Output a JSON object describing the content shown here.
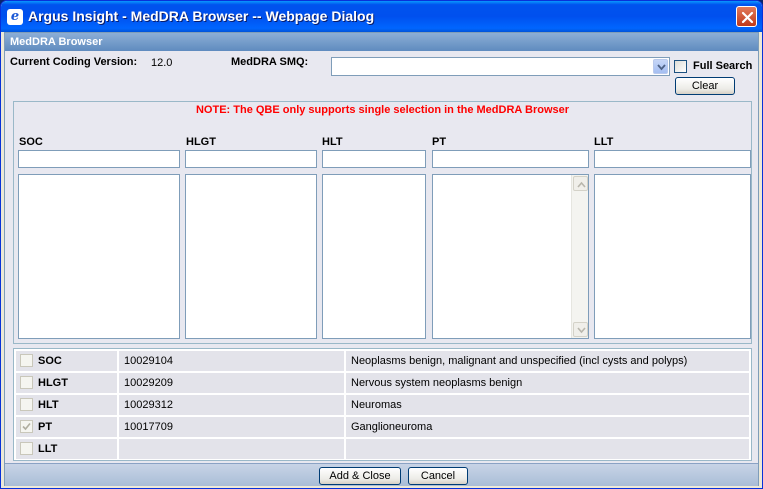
{
  "window": {
    "title": "Argus Insight - MedDRA Browser -- Webpage Dialog",
    "icon": "ie-icon"
  },
  "section_title": "MedDRA Browser",
  "coding": {
    "label": "Current Coding Version:",
    "value": "12.0"
  },
  "smq": {
    "label": "MedDRA SMQ:",
    "selected": ""
  },
  "full_search": {
    "label": "Full Search",
    "checked": false
  },
  "clear_label": "Clear",
  "note": "NOTE: The QBE only supports single selection in the MedDRA Browser",
  "columns": [
    {
      "label": "SOC",
      "input_value": ""
    },
    {
      "label": "HLGT",
      "input_value": ""
    },
    {
      "label": "HLT",
      "input_value": ""
    },
    {
      "label": "PT",
      "input_value": ""
    },
    {
      "label": "LLT",
      "input_value": ""
    }
  ],
  "selection": [
    {
      "level": "SOC",
      "code": "10029104",
      "term": "Neoplasms benign, malignant and unspecified (incl cysts and polyps)",
      "checked": false
    },
    {
      "level": "HLGT",
      "code": "10029209",
      "term": "Nervous system neoplasms benign",
      "checked": false
    },
    {
      "level": "HLT",
      "code": "10029312",
      "term": "Neuromas",
      "checked": false
    },
    {
      "level": "PT",
      "code": "10017709",
      "term": "Ganglioneuroma",
      "checked": true
    },
    {
      "level": "LLT",
      "code": "",
      "term": "",
      "checked": false
    }
  ],
  "buttons": {
    "add_close": "Add & Close",
    "cancel": "Cancel"
  },
  "colors": {
    "title_bar": "#0053ee",
    "note": "#ff0000",
    "section_header": "#6f97c8"
  }
}
